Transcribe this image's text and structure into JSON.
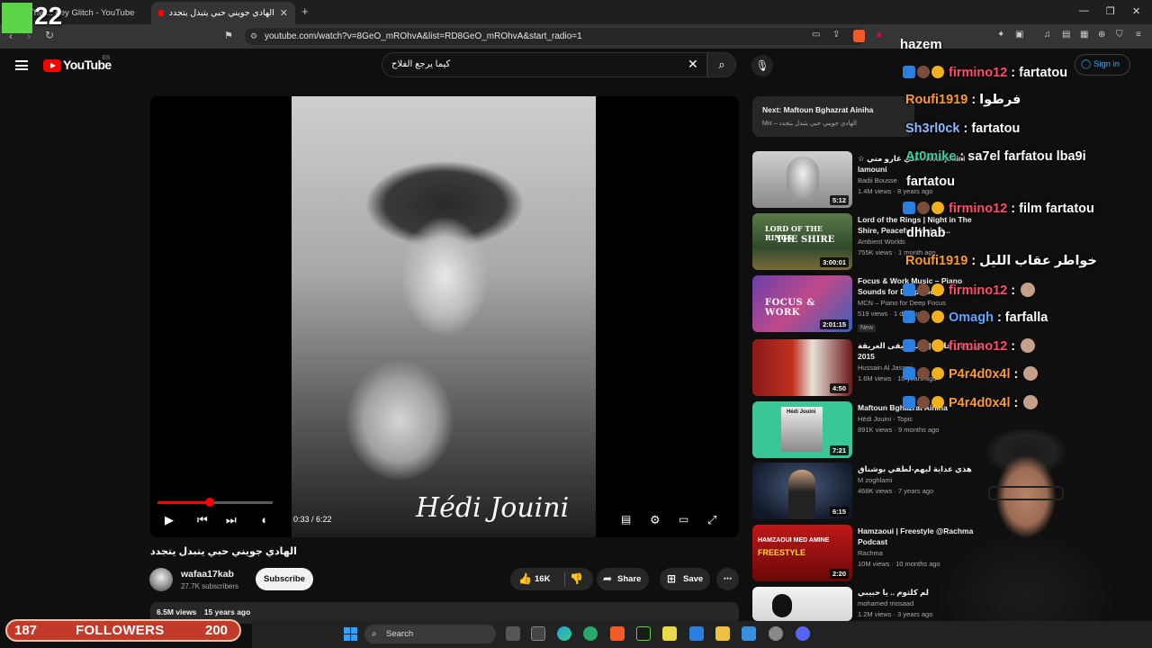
{
  "browser": {
    "tabs": [
      {
        "label": "The ... ney Glitch - YouTube",
        "active": false
      },
      {
        "label": "الهادي جويني حبي يتبدل يتجدد",
        "active": true
      }
    ],
    "url": "youtube.com/watch?v=8GeO_mROhvA&list=RD8GeO_mROhvA&start_radio=1",
    "window_controls": [
      "—",
      "❐",
      "✕"
    ]
  },
  "youtube": {
    "wordmark": "YouTube",
    "region": "ES",
    "search_query": "كيما يرجع الفلاح",
    "signin_label": "Sign in"
  },
  "player": {
    "time": "0:33 / 6:22",
    "progress_fraction": 0.45,
    "signature": "Hédi Jouini"
  },
  "video": {
    "title": "الهادي جويني حبي يتبدل يتجدد",
    "channel": "wafaa17kab",
    "subscribers": "27.7K subscribers",
    "subscribe_label": "Subscribe",
    "likes": "16K",
    "share_label": "Share",
    "save_label": "Save",
    "views": "6.5M views",
    "age": "15 years ago"
  },
  "up_next": {
    "title": "Next: Maftoun Bghazrat Ainiha",
    "subtitle": "Mix – الهادي جويني حبي يتبدل يتجدد"
  },
  "recommendations": [
    {
      "title": "☆ الي غارو مني☆ Hedi jouini ☆ lamouni",
      "channel": "Badii Bousse",
      "meta": "1.4M views · 8 years ago",
      "duration": "5:12",
      "badge": ""
    },
    {
      "title": "Lord of the Rings | Night in The Shire, Peaceful Music &...",
      "channel": "Ambient Worlds",
      "meta": "755K views · 1 month ago",
      "duration": "3:00:01",
      "badge": "",
      "thumb_line1": "LORD OF THE RINGS",
      "thumb_line2": "THE SHIRE"
    },
    {
      "title": "Focus & Work Music – Piano Sounds for Deep Focus",
      "channel": "MCN – Piano for Deep Focus",
      "meta": "519 views · 1 day ago",
      "duration": "2:01:15",
      "badge": "New",
      "thumb_line1": "FOCUS & WORK"
    },
    {
      "title": "مهرجان فاس | الموسيقى العريقة 2015",
      "channel": "Hussain Al Jassmi",
      "meta": "1.6M views · 10 years ago",
      "duration": "4:50",
      "badge": ""
    },
    {
      "title": "Maftoun Bghazrat Ainiha",
      "channel": "Hédi Jouini - Topic",
      "meta": "891K views · 9 months ago",
      "duration": "7:21",
      "badge": "",
      "thumb_line1": "Hédi Jouini"
    },
    {
      "title": "هذي عداية ليهم-لطفي بوشناق",
      "channel": "M zoghlami",
      "meta": "468K views · 7 years ago",
      "duration": "6:15",
      "badge": ""
    },
    {
      "title": "Hamzaoui | Freestyle @Rachma Podcast",
      "channel": "Rachma",
      "meta": "10M views · 10 months ago",
      "duration": "2:20",
      "badge": "",
      "thumb_line1": "HAMZAOUI MED AMINE",
      "thumb_line2": "FREESTYLE"
    },
    {
      "title": "لم كلثوم .. يا حبيبي",
      "channel": "mohamed mosaad",
      "meta": "1.2M views · 3 years ago",
      "duration": "",
      "badge": ""
    }
  ],
  "chat": {
    "header": "hazem",
    "messages": [
      {
        "user": "firmino12",
        "color": "#ff4d6a",
        "text": ": fartatou",
        "badges": true
      },
      {
        "user": "Roufi1919",
        "color": "#ff9a2e",
        "text": ": فرطوا",
        "badges": false
      },
      {
        "user": "Sh3rl0ck",
        "color": "#8fb8ff",
        "text": ": fartatou",
        "badges": false
      },
      {
        "user": "At0mike",
        "color": "#3fd0a0",
        "text": ": sa7el farfatou lba9i",
        "badges": false
      },
      {
        "user": "",
        "color": "#ffffff",
        "text": "fartatou",
        "badges": false
      },
      {
        "user": "firmino12",
        "color": "#ff4d6a",
        "text": ": film fartatou",
        "badges": true
      },
      {
        "user": "",
        "color": "#ffffff",
        "text": "dhhab",
        "badges": false
      },
      {
        "user": "Roufi1919",
        "color": "#ff9a2e",
        "text": ": خواطر عقاب الليل",
        "badges": false
      },
      {
        "user": "firmino12",
        "color": "#ff4d6a",
        "text": ":",
        "badges": true
      },
      {
        "user": "Omagh",
        "color": "#5aa8ff",
        "text": ": farfalla",
        "badges": true
      },
      {
        "user": "firmino12",
        "color": "#ff4d6a",
        "text": ":",
        "badges": true
      },
      {
        "user": "P4r4d0x4l",
        "color": "#ff9a2e",
        "text": ":",
        "badges": true
      },
      {
        "user": "P4r4d0x4l",
        "color": "#ff9a2e",
        "text": ":",
        "badges": true
      }
    ]
  },
  "stream": {
    "logo_number": "22",
    "followers_current": "187",
    "followers_label": "FOLLOWERS",
    "followers_goal": "200"
  },
  "taskbar": {
    "search_label": "Search"
  }
}
